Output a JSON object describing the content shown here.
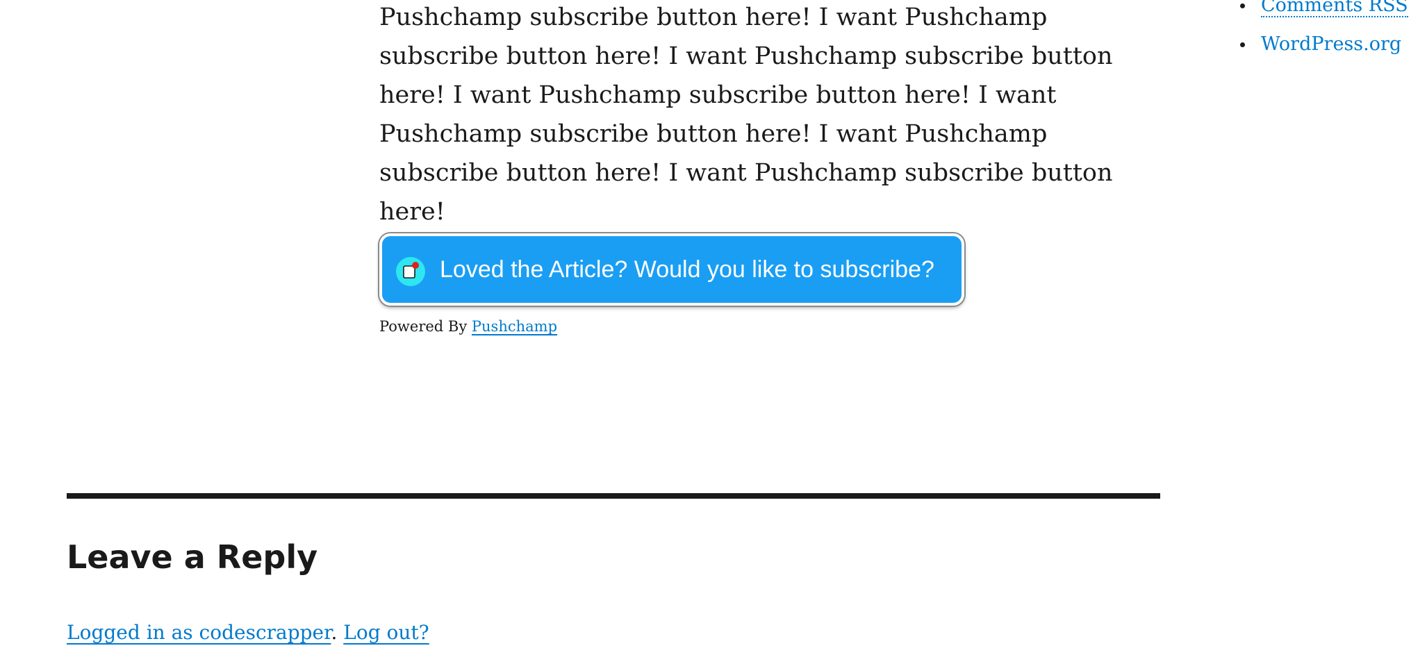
{
  "article": {
    "text": "Pushchamp subscribe button here! I want Pushchamp subscribe button here! I want Pushchamp subscribe button here! I want Pushchamp subscribe button here! I want Pushchamp subscribe button here! I want Pushchamp subscribe button here! I want Pushchamp subscribe button here!"
  },
  "subscribe": {
    "label": "Loved the Article? Would you like to subscribe?",
    "icon": "notification-bell-icon",
    "button_color": "#1a9ef3"
  },
  "powered_by": {
    "prefix": "Powered By ",
    "link": "Pushchamp"
  },
  "sidebar": {
    "items": [
      {
        "label": "Comments RSS"
      },
      {
        "label": "WordPress.org"
      }
    ]
  },
  "reply": {
    "heading": "Leave a Reply",
    "logged_in_link": "Logged in as codescrapper",
    "separator": ". ",
    "logout_link": "Log out?"
  },
  "colors": {
    "link": "#007acc",
    "text": "#1a1a1a"
  }
}
